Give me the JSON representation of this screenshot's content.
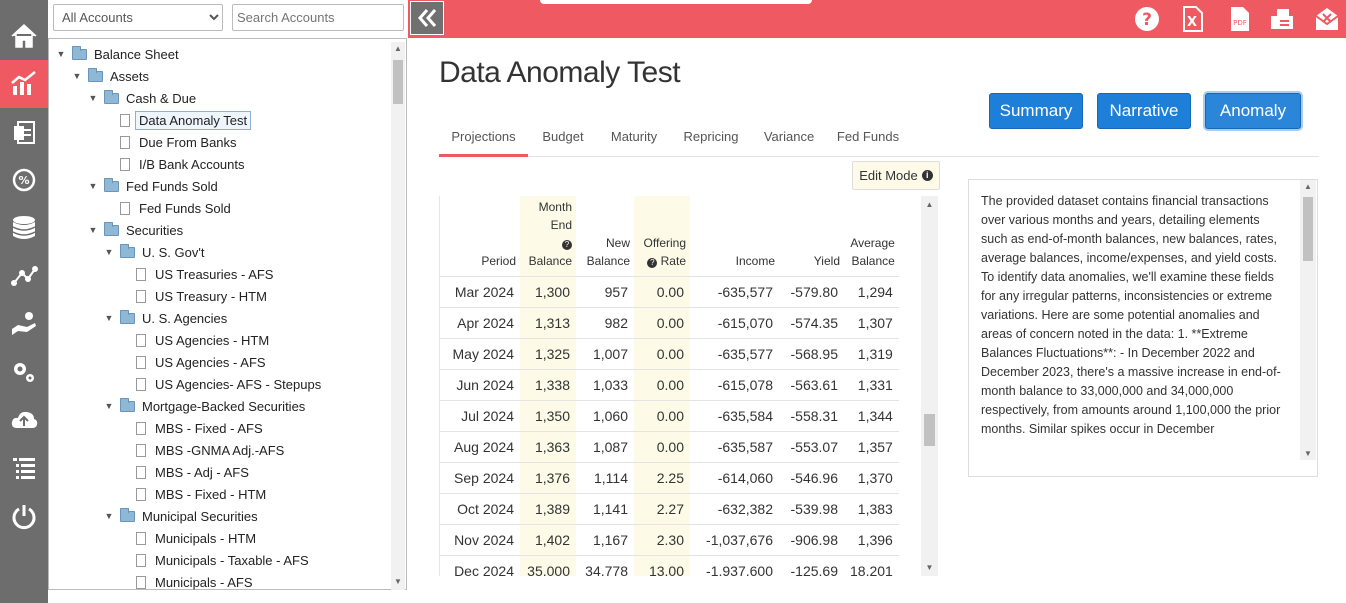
{
  "sidebar_rail": [
    {
      "name": "home-icon"
    },
    {
      "name": "chart-icon",
      "active": true
    },
    {
      "name": "report-icon"
    },
    {
      "name": "rate-cycle-icon"
    },
    {
      "name": "database-icon"
    },
    {
      "name": "network-icon"
    },
    {
      "name": "hand-icon"
    },
    {
      "name": "settings-icon"
    },
    {
      "name": "cloud-upload-icon"
    },
    {
      "name": "list-icon"
    },
    {
      "name": "power-icon"
    }
  ],
  "tree_header": {
    "account_filter": "All Accounts",
    "search_placeholder": "Search Accounts"
  },
  "tree": [
    {
      "label": "Balance Sheet",
      "type": "folder",
      "level": 0
    },
    {
      "label": "Assets",
      "type": "folder",
      "level": 1
    },
    {
      "label": "Cash & Due",
      "type": "folder",
      "level": 2
    },
    {
      "label": "Data Anomaly Test",
      "type": "doc",
      "level": 3,
      "selected": true
    },
    {
      "label": "Due From Banks",
      "type": "doc",
      "level": 3
    },
    {
      "label": "I/B Bank Accounts",
      "type": "doc",
      "level": 3
    },
    {
      "label": "Fed Funds Sold",
      "type": "folder",
      "level": 2
    },
    {
      "label": "Fed Funds Sold",
      "type": "doc",
      "level": 3
    },
    {
      "label": "Securities",
      "type": "folder",
      "level": 2
    },
    {
      "label": "U. S. Gov't",
      "type": "folder",
      "level": 3
    },
    {
      "label": "US Treasuries - AFS",
      "type": "doc",
      "level": 4
    },
    {
      "label": "US Treasury - HTM",
      "type": "doc",
      "level": 4
    },
    {
      "label": "U. S. Agencies",
      "type": "folder",
      "level": 3
    },
    {
      "label": "US Agencies - HTM",
      "type": "doc",
      "level": 4
    },
    {
      "label": "US Agencies - AFS",
      "type": "doc",
      "level": 4
    },
    {
      "label": "US Agencies- AFS - Stepups",
      "type": "doc",
      "level": 4
    },
    {
      "label": "Mortgage-Backed Securities",
      "type": "folder",
      "level": 3
    },
    {
      "label": "MBS - Fixed - AFS",
      "type": "doc",
      "level": 4
    },
    {
      "label": "MBS -GNMA Adj.-AFS",
      "type": "doc",
      "level": 4
    },
    {
      "label": "MBS - Adj - AFS",
      "type": "doc",
      "level": 4
    },
    {
      "label": "MBS - Fixed - HTM",
      "type": "doc",
      "level": 4
    },
    {
      "label": "Municipal Securities",
      "type": "folder",
      "level": 3
    },
    {
      "label": "Municipals - HTM",
      "type": "doc",
      "level": 4
    },
    {
      "label": "Municipals - Taxable - AFS",
      "type": "doc",
      "level": 4
    },
    {
      "label": "Municipals - AFS",
      "type": "doc",
      "level": 4
    }
  ],
  "top_icons": [
    "help-icon",
    "excel-icon",
    "pdf-icon",
    "fax-icon",
    "email-icon"
  ],
  "page_title": "Data Anomaly Test",
  "view_buttons": {
    "summary": "Summary",
    "narrative": "Narrative",
    "anomaly": "Anomaly"
  },
  "tabs": [
    "Projections",
    "Budget",
    "Maturity",
    "Repricing",
    "Variance",
    "Fed Funds"
  ],
  "active_tab": "Projections",
  "edit_mode_label": "Edit Mode",
  "table": {
    "headers": {
      "period": "Period",
      "month_end_1": "Month",
      "month_end_2": "End",
      "month_end_3": "Balance",
      "new_balance_1": "New",
      "new_balance_2": "Balance",
      "offering_1": "Offering",
      "offering_2": "Rate",
      "income": "Income",
      "yield": "Yield",
      "avg_1": "Average",
      "avg_2": "Balance"
    },
    "rows": [
      {
        "period": "Mar 2024",
        "meb": "1,300",
        "nb": "957",
        "rate": "0.00",
        "income": "-635,577",
        "yield": "-579.80",
        "avg": "1,294"
      },
      {
        "period": "Apr 2024",
        "meb": "1,313",
        "nb": "982",
        "rate": "0.00",
        "income": "-615,070",
        "yield": "-574.35",
        "avg": "1,307"
      },
      {
        "period": "May 2024",
        "meb": "1,325",
        "nb": "1,007",
        "rate": "0.00",
        "income": "-635,577",
        "yield": "-568.95",
        "avg": "1,319"
      },
      {
        "period": "Jun 2024",
        "meb": "1,338",
        "nb": "1,033",
        "rate": "0.00",
        "income": "-615,078",
        "yield": "-563.61",
        "avg": "1,331"
      },
      {
        "period": "Jul 2024",
        "meb": "1,350",
        "nb": "1,060",
        "rate": "0.00",
        "income": "-635,584",
        "yield": "-558.31",
        "avg": "1,344"
      },
      {
        "period": "Aug 2024",
        "meb": "1,363",
        "nb": "1,087",
        "rate": "0.00",
        "income": "-635,587",
        "yield": "-553.07",
        "avg": "1,357"
      },
      {
        "period": "Sep 2024",
        "meb": "1,376",
        "nb": "1,114",
        "rate": "2.25",
        "income": "-614,060",
        "yield": "-546.96",
        "avg": "1,370"
      },
      {
        "period": "Oct 2024",
        "meb": "1,389",
        "nb": "1,141",
        "rate": "2.27",
        "income": "-632,382",
        "yield": "-539.98",
        "avg": "1,383"
      },
      {
        "period": "Nov 2024",
        "meb": "1,402",
        "nb": "1,167",
        "rate": "2.30",
        "income": "-1,037,676",
        "yield": "-906.98",
        "avg": "1,396"
      },
      {
        "period": "Dec 2024",
        "meb": "35,000",
        "nb": "34,778",
        "rate": "13.00",
        "income": "-1,937,600",
        "yield": "-125.69",
        "avg": "18,201"
      }
    ]
  },
  "narrative_text": "The provided dataset contains financial transactions over various months and years, detailing elements such as end-of-month balances, new balances, rates, average balances, income/expenses, and yield costs. To identify data anomalies, we'll examine these fields for any irregular patterns, inconsistencies or extreme variations. Here are some potential anomalies and areas of concern noted in the data: 1. **Extreme Balances Fluctuations**: - In December 2022 and December 2023, there's a massive increase in end-of-month balance to 33,000,000 and 34,000,000 respectively, from amounts around 1,100,000 the prior months. Similar spikes occur in December",
  "colors": {
    "brand": "#ef5a62",
    "button": "#1e7fd9",
    "rail": "#6d6d6d",
    "highlight": "#fdfbe8"
  }
}
